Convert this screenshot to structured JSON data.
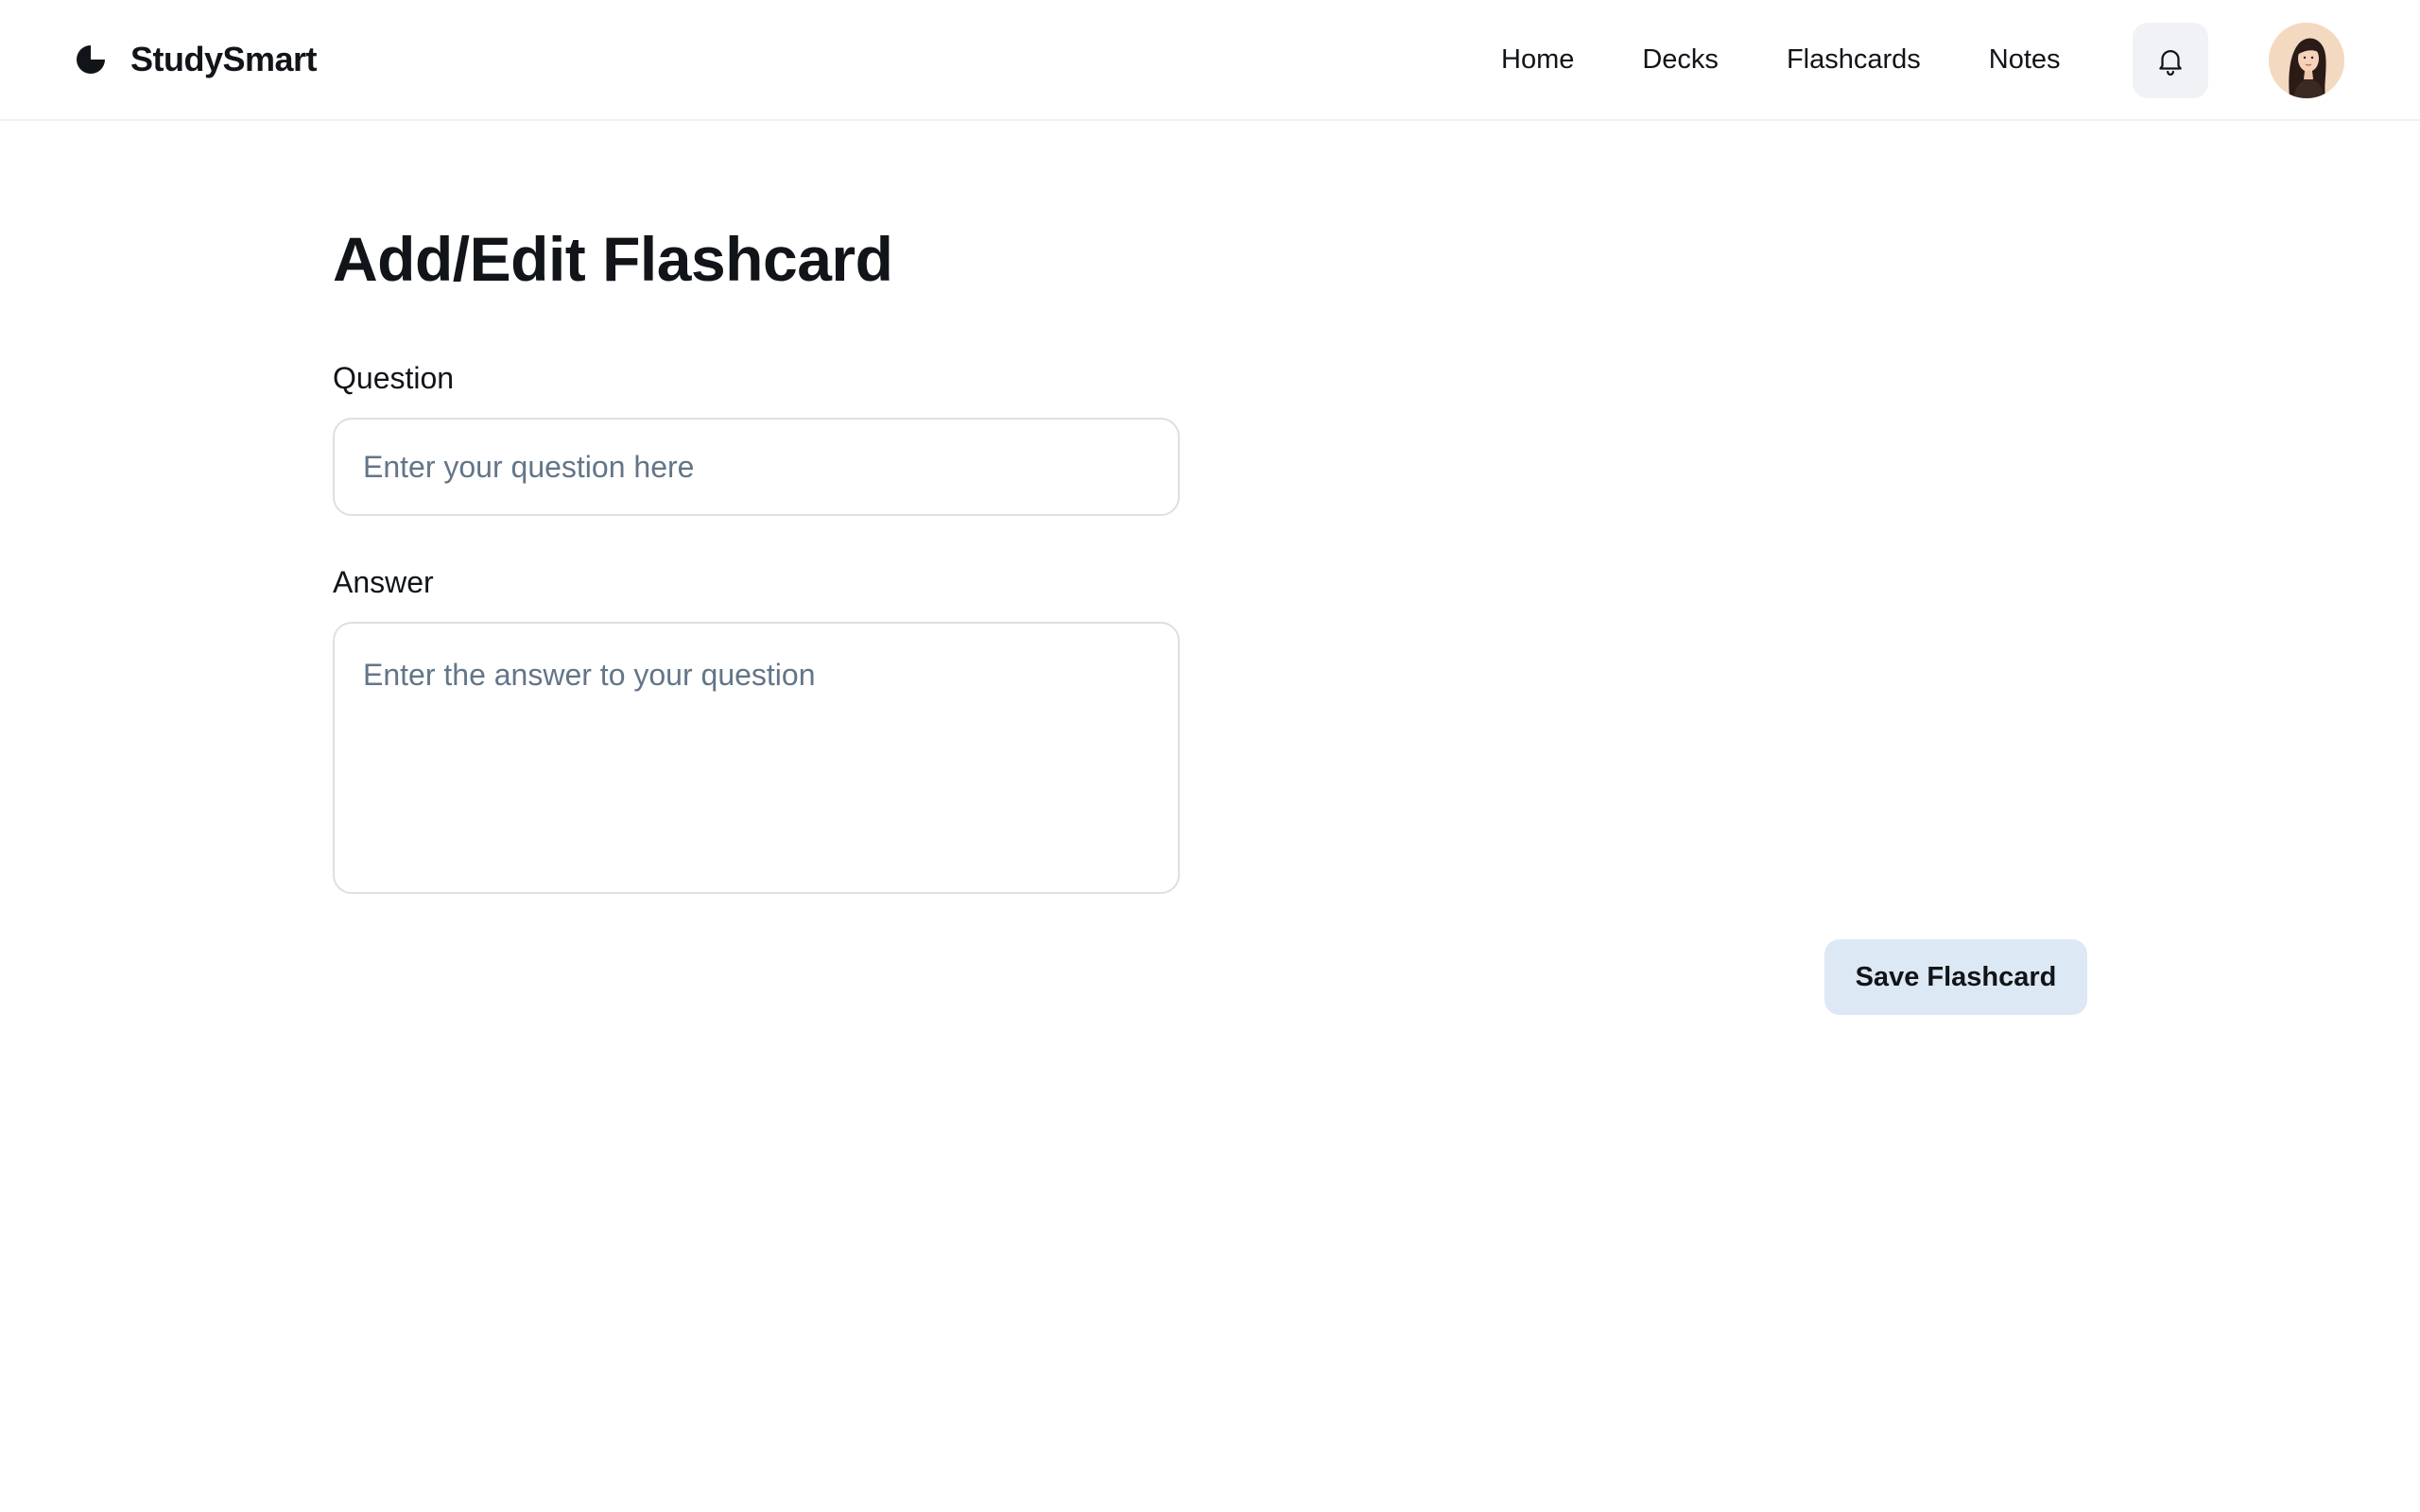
{
  "app": {
    "name": "StudySmart",
    "logo_icon": "half-circle-logo-icon"
  },
  "nav": {
    "items": [
      {
        "label": "Home"
      },
      {
        "label": "Decks"
      },
      {
        "label": "Flashcards"
      },
      {
        "label": "Notes"
      }
    ],
    "notification_icon": "bell-icon",
    "avatar": "user-avatar"
  },
  "page": {
    "title": "Add/Edit Flashcard"
  },
  "form": {
    "question": {
      "label": "Question",
      "value": "",
      "placeholder": "Enter your question here"
    },
    "answer": {
      "label": "Answer",
      "value": "",
      "placeholder": "Enter the answer to your question"
    },
    "save_label": "Save Flashcard"
  },
  "colors": {
    "text": "#111418",
    "placeholder": "#637588",
    "border": "#dbe0e5",
    "notification_bg": "#f0f2f5",
    "save_button_bg": "#dce8f3",
    "avatar_bg": "#f3d9c0"
  }
}
